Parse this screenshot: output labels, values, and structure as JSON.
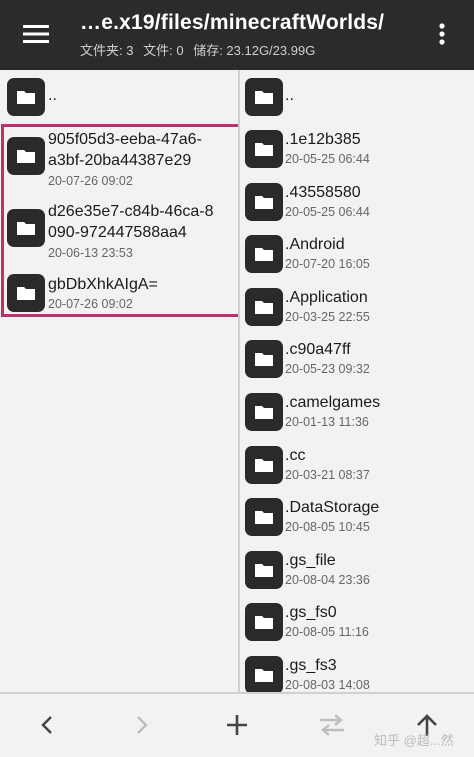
{
  "header": {
    "title": "…e.x19/files/minecraftWorlds/",
    "folders_label": "文件夹: 3",
    "files_label": "文件: 0",
    "storage_label": "储存: 23.12G/23.99G"
  },
  "left_pane": {
    "parent": "..",
    "items": [
      {
        "name_line1": "905f05d3-eeba-47a6-",
        "name_line2": "a3bf-20ba44387e29",
        "date": "20-07-26 09:02"
      },
      {
        "name_line1": "d26e35e7-c84b-46ca-8",
        "name_line2": "090-972447588aa4",
        "date": "20-06-13 23:53"
      },
      {
        "name_line1": "gbDbXhkAIgA=",
        "date": "20-07-26 09:02"
      }
    ]
  },
  "right_pane": {
    "parent": "..",
    "items": [
      {
        "name": ".1e12b385",
        "date": "20-05-25 06:44"
      },
      {
        "name": ".43558580",
        "date": "20-05-25 06:44"
      },
      {
        "name": ".Android",
        "date": "20-07-20 16:05"
      },
      {
        "name": ".Application",
        "date": "20-03-25 22:55"
      },
      {
        "name": ".c90a47ff",
        "date": "20-05-23 09:32"
      },
      {
        "name": ".camelgames",
        "date": "20-01-13 11:36"
      },
      {
        "name": ".cc",
        "date": "20-03-21 08:37"
      },
      {
        "name": ".DataStorage",
        "date": "20-08-05 10:45"
      },
      {
        "name": ".gs_file",
        "date": "20-08-04 23:36"
      },
      {
        "name": ".gs_fs0",
        "date": "20-08-05 11:16"
      },
      {
        "name": ".gs_fs3",
        "date": "20-08-03 14:08"
      }
    ]
  },
  "bottom_bar": {
    "watermark": "知乎 @超...然"
  },
  "colors": {
    "topbar": "#2b2b2b",
    "selection": "#c1306a",
    "folder": "#2a2a2a"
  },
  "icons": [
    "menu-icon",
    "more-vert-icon",
    "folder-icon",
    "back-icon",
    "forward-icon",
    "add-icon",
    "swap-icon",
    "up-icon"
  ]
}
